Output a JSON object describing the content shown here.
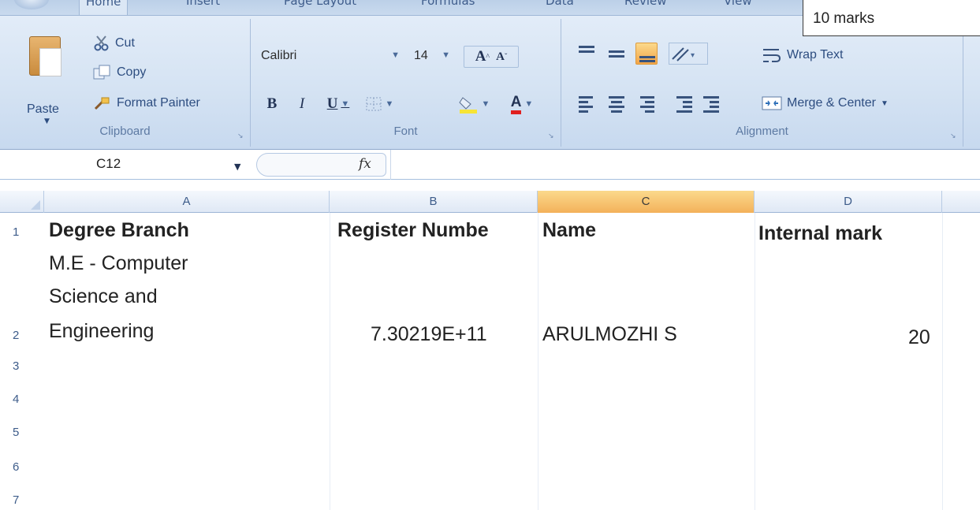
{
  "tabs": [
    "Home",
    "Insert",
    "Page Layout",
    "Formulas",
    "Data",
    "Review",
    "View"
  ],
  "clipboard": {
    "paste_label": "Paste",
    "cut_label": "Cut",
    "copy_label": "Copy",
    "format_painter_label": "Format Painter",
    "group_label": "Clipboard"
  },
  "font": {
    "name": "Calibri",
    "size": "14",
    "grow_label": "A",
    "shrink_label": "A",
    "bold_label": "B",
    "italic_label": "I",
    "underline_label": "U",
    "color_label": "A",
    "group_label": "Font"
  },
  "alignment": {
    "wrap_text_label": "Wrap Text",
    "merge_center_label": "Merge & Center",
    "group_label": "Alignment"
  },
  "formula_bar": {
    "name_box": "C12",
    "fx_label": "fx",
    "formula": ""
  },
  "grid": {
    "columns": [
      "A",
      "B",
      "C",
      "D"
    ],
    "selected_column": "C",
    "rows": [
      "1",
      "2",
      "3",
      "4",
      "5",
      "6",
      "7"
    ],
    "cells": {
      "A1": "Degree Branch",
      "B1": "Register Numbe",
      "C1": "Name",
      "D1": "Internal mark",
      "A2_lines": [
        "M.E - Computer",
        "Science and",
        "Engineering"
      ],
      "B2": "7.30219E+11",
      "C2": "ARULMOZHI S",
      "D2": "20"
    }
  },
  "comment": {
    "text": "10 marks"
  },
  "colors": {
    "selected_header": "#f3b15a",
    "ribbon": "#d5e3f3",
    "header_text": "#3d5c8a"
  }
}
